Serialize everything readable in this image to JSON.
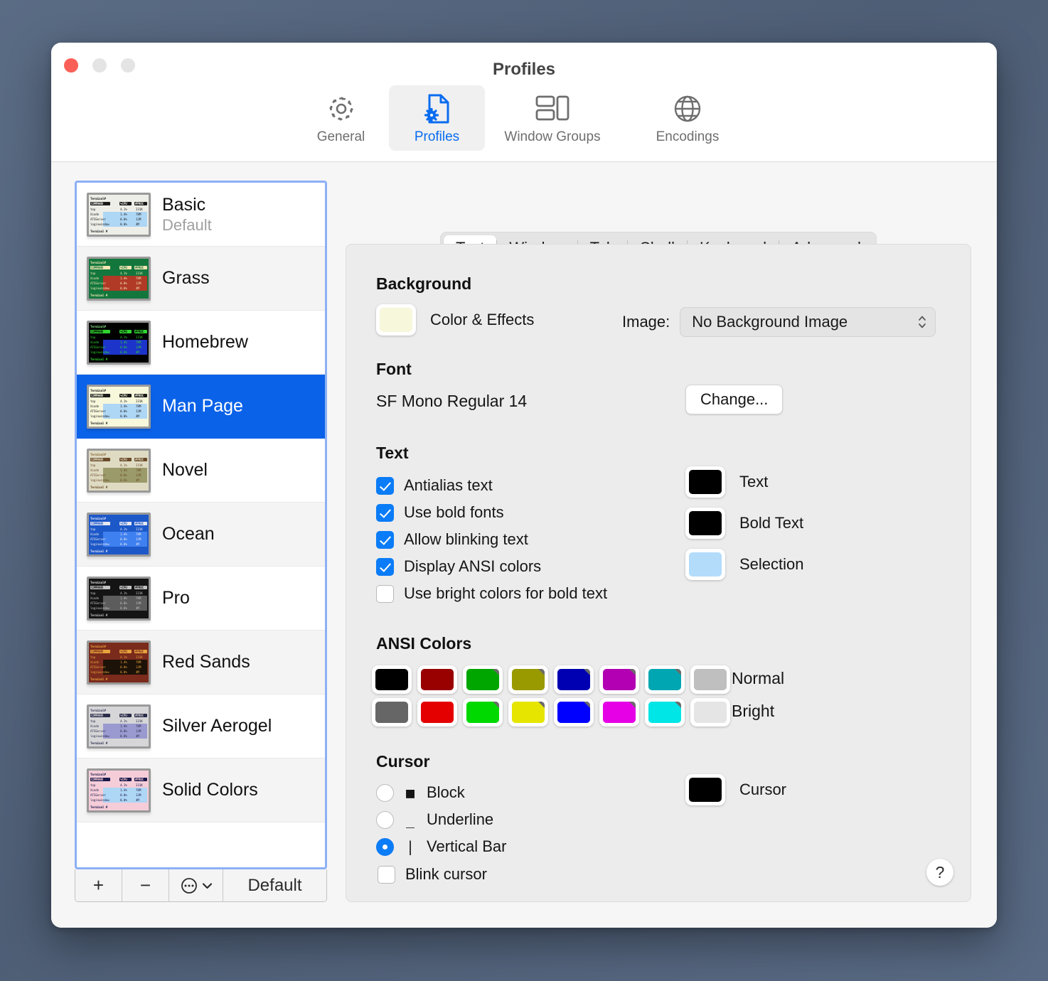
{
  "window": {
    "title": "Profiles",
    "traffic_lights": [
      "close",
      "minimize",
      "maximize"
    ]
  },
  "toolbar": {
    "items": [
      {
        "label": "General",
        "icon": "gear-icon",
        "active": false
      },
      {
        "label": "Profiles",
        "icon": "document-gear-icon",
        "active": true
      },
      {
        "label": "Window Groups",
        "icon": "window-groups-icon",
        "active": false
      },
      {
        "label": "Encodings",
        "icon": "globe-icon",
        "active": false
      }
    ]
  },
  "sidebar": {
    "profiles": [
      {
        "name": "Basic",
        "subtitle": "Default",
        "selected": false
      },
      {
        "name": "Grass",
        "subtitle": "",
        "selected": false
      },
      {
        "name": "Homebrew",
        "subtitle": "",
        "selected": false
      },
      {
        "name": "Man Page",
        "subtitle": "",
        "selected": true
      },
      {
        "name": "Novel",
        "subtitle": "",
        "selected": false
      },
      {
        "name": "Ocean",
        "subtitle": "",
        "selected": false
      },
      {
        "name": "Pro",
        "subtitle": "",
        "selected": false
      },
      {
        "name": "Red Sands",
        "subtitle": "",
        "selected": false
      },
      {
        "name": "Silver Aerogel",
        "subtitle": "",
        "selected": false
      },
      {
        "name": "Solid Colors",
        "subtitle": "",
        "selected": false
      }
    ],
    "footer": {
      "add_label": "+",
      "remove_label": "−",
      "menu_label": "⋯",
      "default_label": "Default"
    }
  },
  "tabs": [
    {
      "label": "Text",
      "active": true
    },
    {
      "label": "Window",
      "active": false
    },
    {
      "label": "Tab",
      "active": false
    },
    {
      "label": "Shell",
      "active": false
    },
    {
      "label": "Keyboard",
      "active": false
    },
    {
      "label": "Advanced",
      "active": false
    }
  ],
  "background": {
    "heading": "Background",
    "color_effects_label": "Color & Effects",
    "color_swatch": "#f7f7dc",
    "image_label": "Image:",
    "image_value": "No Background Image"
  },
  "font": {
    "heading": "Font",
    "value": "SF Mono Regular 14",
    "change_label": "Change..."
  },
  "text": {
    "heading": "Text",
    "checkboxes": [
      {
        "label": "Antialias text",
        "checked": true
      },
      {
        "label": "Use bold fonts",
        "checked": true
      },
      {
        "label": "Allow blinking text",
        "checked": true
      },
      {
        "label": "Display ANSI colors",
        "checked": true
      },
      {
        "label": "Use bright colors for bold text",
        "checked": false
      }
    ],
    "colors": [
      {
        "label": "Text",
        "value": "#000000"
      },
      {
        "label": "Bold Text",
        "value": "#000000"
      },
      {
        "label": "Selection",
        "value": "#b3dcfb"
      }
    ]
  },
  "ansi": {
    "heading": "ANSI Colors",
    "normal_label": "Normal",
    "bright_label": "Bright",
    "normal": [
      "#000000",
      "#990000",
      "#00a600",
      "#999900",
      "#0000b2",
      "#b200b2",
      "#00a6b2",
      "#bfbfbf"
    ],
    "bright": [
      "#666666",
      "#e50000",
      "#00d900",
      "#e5e500",
      "#0000ff",
      "#e500e5",
      "#00e5e5",
      "#e5e5e5"
    ]
  },
  "cursor": {
    "heading": "Cursor",
    "options": [
      {
        "label": "Block",
        "glyph": "■",
        "selected": false
      },
      {
        "label": "Underline",
        "glyph": "_",
        "selected": false
      },
      {
        "label": "Vertical Bar",
        "glyph": "|",
        "selected": true
      }
    ],
    "blink_label": "Blink cursor",
    "blink_checked": false,
    "color_label": "Cursor",
    "color_value": "#000000"
  },
  "help": {
    "label": "?"
  },
  "thumbnails": [
    {
      "bg": "#eeeee8",
      "fg": "#1a1a1a",
      "accent": "#1a1a1a",
      "band": "#aed6f5",
      "prompt": "#1a1a1a"
    },
    {
      "bg": "#13773d",
      "fg": "#f4e6b4",
      "accent": "#f4e6b4",
      "band": "#b03a26",
      "prompt": "#f4e6b4"
    },
    {
      "bg": "#000000",
      "fg": "#2fd62f",
      "accent": "#88e788",
      "band": "#1c34c9",
      "prompt": "#2fd62f"
    },
    {
      "bg": "#f7f7dc",
      "fg": "#1a1a1a",
      "accent": "#1a1a1a",
      "band": "#aed6f5",
      "prompt": "#1a1a1a"
    },
    {
      "bg": "#dfdbc3",
      "fg": "#6b4b2a",
      "accent": "#8a6a3a",
      "band": "#9b9a6a",
      "prompt": "#6b4b2a"
    },
    {
      "bg": "#1d58c9",
      "fg": "#e8e8f0",
      "accent": "#e8e8f0",
      "band": "#3f80f0",
      "prompt": "#e8e8f0"
    },
    {
      "bg": "#141414",
      "fg": "#c2c2c2",
      "accent": "#e0e0e0",
      "band": "#5c5c5c",
      "prompt": "#c2c2c2"
    },
    {
      "bg": "#7a2b1c",
      "fg": "#e8a33d",
      "accent": "#e8a33d",
      "band": "#1c1208",
      "prompt": "#e8a33d"
    },
    {
      "bg": "#d6d6d8",
      "fg": "#2b2b4a",
      "accent": "#3a3a5c",
      "band": "#9a9ad0",
      "prompt": "#2b2b4a"
    },
    {
      "bg": "#f5cdd9",
      "fg": "#1a1a4a",
      "accent": "#1a1a4a",
      "band": "#aed6f5",
      "prompt": "#1a1a4a"
    }
  ],
  "thumb_text": {
    "l0": "Terminal#",
    "l1": "COMMAND",
    "c1": "%CPU",
    "c2": "#PROC",
    "rows": [
      {
        "name": "top",
        "cpu": "4.1%",
        "mem": "231K"
      },
      {
        "name": "Xcode",
        "cpu": "1.4%",
        "mem": "78M"
      },
      {
        "name": "ATSServer",
        "cpu": "0.0%",
        "mem": "13M"
      },
      {
        "name": "loginwindow",
        "cpu": "0.0%",
        "mem": "4M"
      }
    ],
    "prompt": "Terminal #"
  }
}
